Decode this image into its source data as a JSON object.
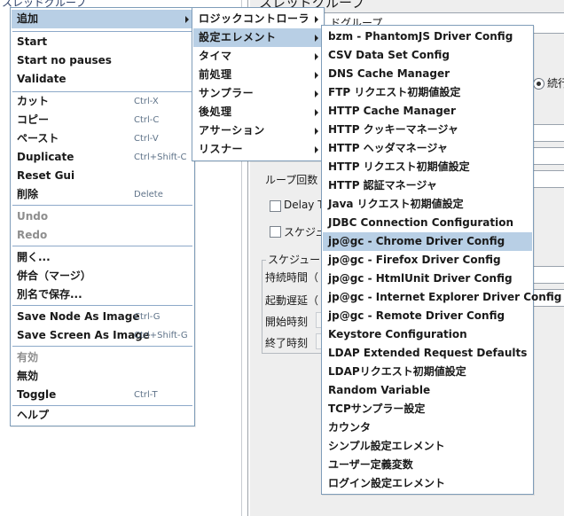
{
  "background": {
    "tree_label": "スレッドグループ",
    "panel_title": "スレッドグループ",
    "name_field_value": "ドグループ",
    "radio_label": "続行",
    "loop_label": "ループ回数",
    "delay_label": "Delay Th",
    "scheduler_label": "スケジュ",
    "scheduler_group_title": "スケジュー",
    "duration_label": "持続時間（",
    "startup_delay_label": "起動遅延（",
    "start_time_label": "開始時刻",
    "end_time_label": "終了時刻"
  },
  "context_menu": {
    "items": [
      {
        "label": "追加",
        "accel": "",
        "submenu": true,
        "highlighted": true
      },
      {
        "label": "Start",
        "accel": ""
      },
      {
        "label": "Start no pauses",
        "accel": ""
      },
      {
        "label": "Validate",
        "accel": ""
      },
      {
        "label": "カット",
        "accel": "Ctrl-X"
      },
      {
        "label": "コピー",
        "accel": "Ctrl-C"
      },
      {
        "label": "ペースト",
        "accel": "Ctrl-V"
      },
      {
        "label": "Duplicate",
        "accel": "Ctrl+Shift-C"
      },
      {
        "label": "Reset Gui",
        "accel": ""
      },
      {
        "label": "削除",
        "accel": "Delete"
      },
      {
        "label": "Undo",
        "accel": "",
        "disabled": true
      },
      {
        "label": "Redo",
        "accel": "",
        "disabled": true
      },
      {
        "label": "開く...",
        "accel": ""
      },
      {
        "label": "併合（マージ）",
        "accel": ""
      },
      {
        "label": "別名で保存...",
        "accel": ""
      },
      {
        "label": "Save Node As Image",
        "accel": "Ctrl-G"
      },
      {
        "label": "Save Screen As Image",
        "accel": "Ctrl+Shift-G"
      },
      {
        "label": "有効",
        "accel": "",
        "disabled": true
      },
      {
        "label": "無効",
        "accel": ""
      },
      {
        "label": "Toggle",
        "accel": "Ctrl-T"
      },
      {
        "label": "ヘルプ",
        "accel": ""
      }
    ]
  },
  "add_submenu": {
    "items": [
      {
        "label": "ロジックコントローラ",
        "submenu": true
      },
      {
        "label": "設定エレメント",
        "submenu": true,
        "highlighted": true
      },
      {
        "label": "タイマ",
        "submenu": true
      },
      {
        "label": "前処理",
        "submenu": true
      },
      {
        "label": "サンプラー",
        "submenu": true
      },
      {
        "label": "後処理",
        "submenu": true
      },
      {
        "label": "アサーション",
        "submenu": true
      },
      {
        "label": "リスナー",
        "submenu": true
      }
    ]
  },
  "config_submenu": {
    "items": [
      {
        "label": "bzm - PhantomJS Driver Config"
      },
      {
        "label": "CSV Data Set Config"
      },
      {
        "label": "DNS Cache Manager"
      },
      {
        "label": "FTP リクエスト初期値設定"
      },
      {
        "label": "HTTP Cache Manager"
      },
      {
        "label": "HTTP クッキーマネージャ"
      },
      {
        "label": "HTTP ヘッダマネージャ"
      },
      {
        "label": "HTTP リクエスト初期値設定"
      },
      {
        "label": "HTTP 認証マネージャ"
      },
      {
        "label": "Java リクエスト初期値設定"
      },
      {
        "label": "JDBC Connection Configuration"
      },
      {
        "label": "jp@gc - Chrome Driver Config",
        "highlighted": true
      },
      {
        "label": "jp@gc - Firefox Driver Config"
      },
      {
        "label": "jp@gc - HtmlUnit Driver Config"
      },
      {
        "label": "jp@gc - Internet Explorer Driver Config"
      },
      {
        "label": "jp@gc - Remote Driver Config"
      },
      {
        "label": "Keystore Configuration"
      },
      {
        "label": "LDAP Extended Request Defaults"
      },
      {
        "label": "LDAPリクエスト初期値設定"
      },
      {
        "label": "Random Variable"
      },
      {
        "label": "TCPサンプラー設定"
      },
      {
        "label": "カウンタ"
      },
      {
        "label": "シンプル設定エレメント"
      },
      {
        "label": "ユーザー定義変数"
      },
      {
        "label": "ログイン設定エレメント"
      }
    ]
  },
  "colors": {
    "menu_border": "#7f9db9",
    "highlight": "#b8cfe5",
    "separator": "#8da9c9",
    "accelerator": "#5f7389",
    "disabled": "#8e8e8e",
    "panel_bg": "#eeeeee"
  }
}
